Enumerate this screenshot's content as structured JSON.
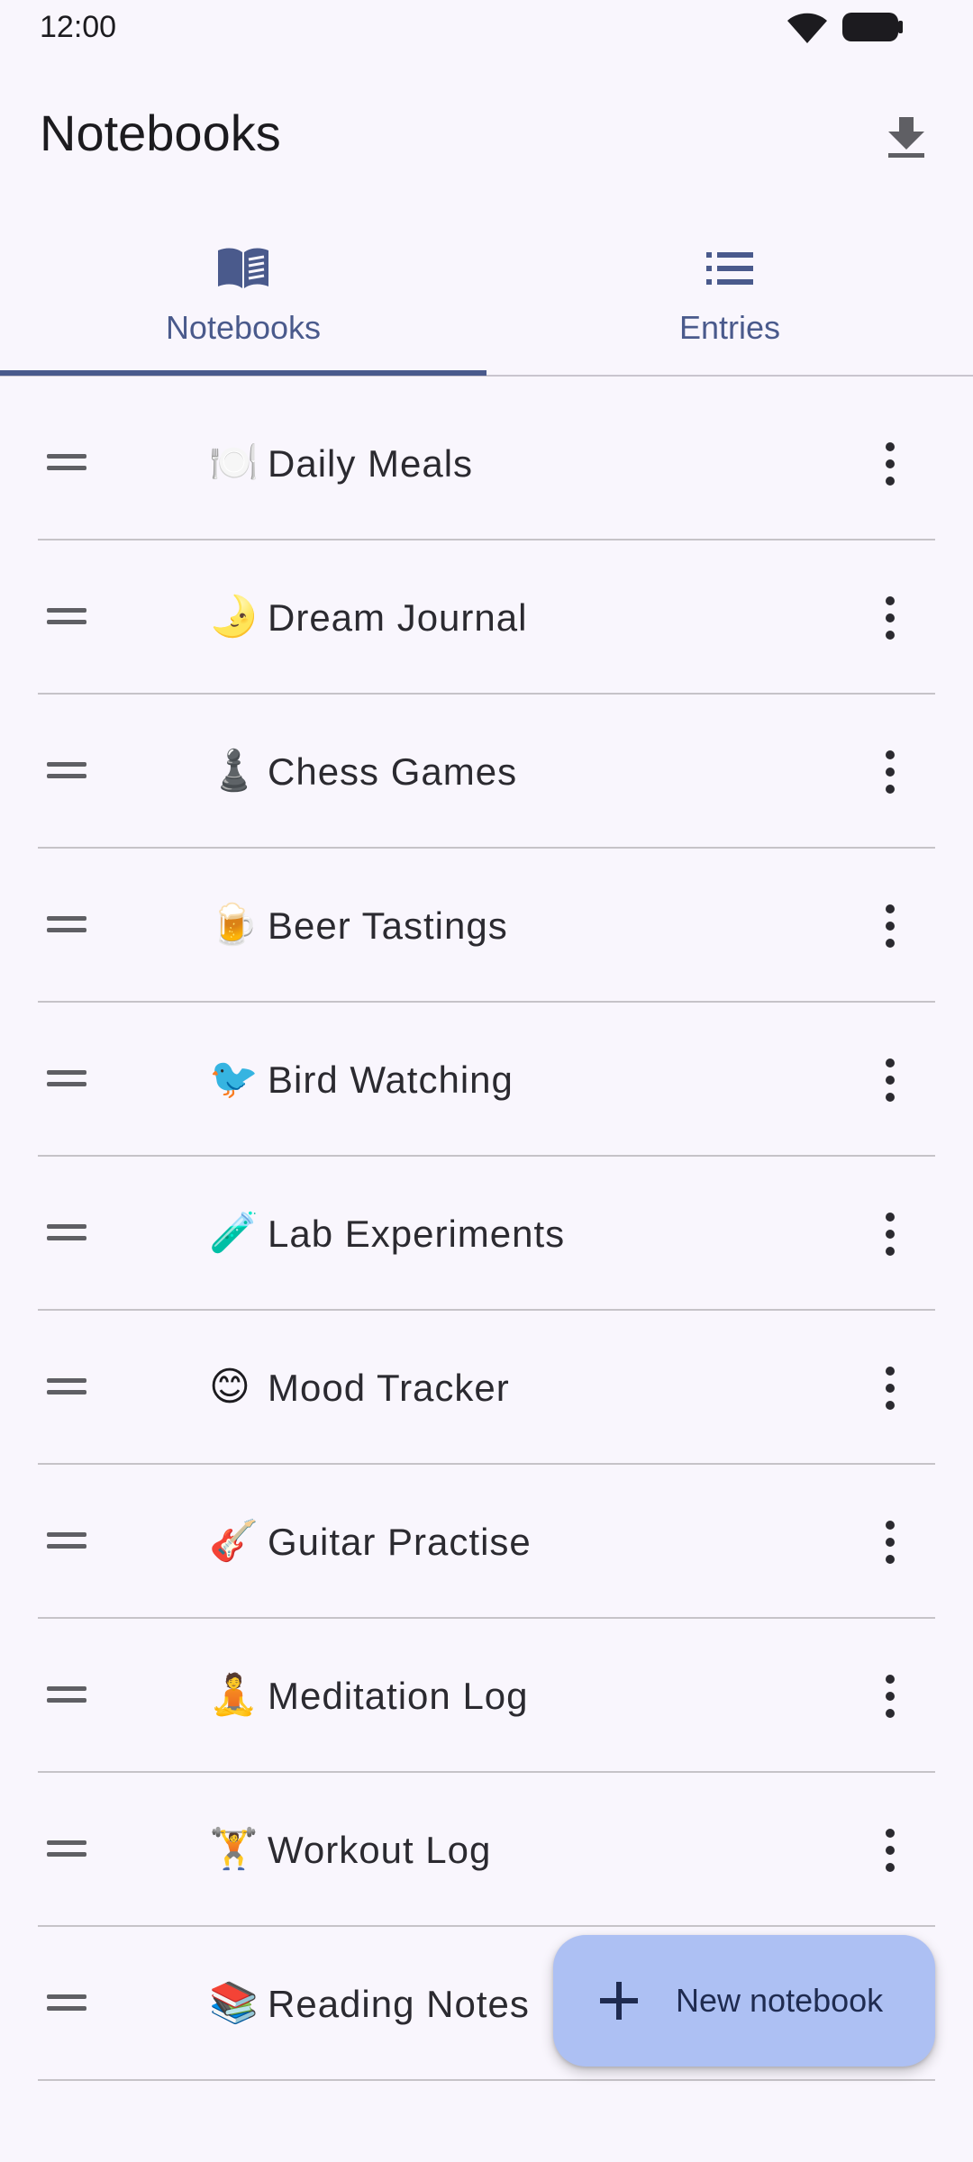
{
  "status_bar": {
    "time": "12:00"
  },
  "app_bar": {
    "title": "Notebooks",
    "action_icon": "download-icon"
  },
  "tabs": [
    {
      "label": "Notebooks",
      "icon": "notebook-icon",
      "selected": true
    },
    {
      "label": "Entries",
      "icon": "list-icon",
      "selected": false
    }
  ],
  "notebooks": [
    {
      "emoji": "🍽️",
      "name": "Daily Meals"
    },
    {
      "emoji": "🌛",
      "name": "Dream Journal"
    },
    {
      "emoji": "♟️",
      "name": "Chess Games"
    },
    {
      "emoji": "🍺",
      "name": "Beer Tastings"
    },
    {
      "emoji": "🐦",
      "name": "Bird Watching"
    },
    {
      "emoji": "🧪",
      "name": "Lab Experiments"
    },
    {
      "emoji": "😊",
      "name": "Mood Tracker"
    },
    {
      "emoji": "🎸",
      "name": "Guitar Practise"
    },
    {
      "emoji": "🧘",
      "name": "Meditation Log"
    },
    {
      "emoji": "🏋️",
      "name": "Workout Log"
    },
    {
      "emoji": "📚",
      "name": "Reading Notes"
    }
  ],
  "fab": {
    "label": "New notebook",
    "icon": "plus-icon"
  },
  "colors": {
    "background": "#F9F6FD",
    "accent": "#4A5A8C",
    "fab": "#ADC0F3"
  }
}
